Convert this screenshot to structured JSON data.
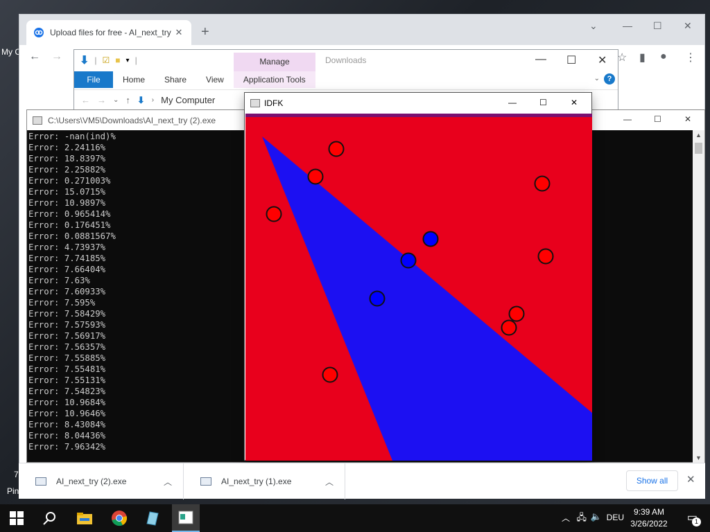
{
  "desktop": {
    "icon_label_1": "My C",
    "icon_label_2": "Pin",
    "icon_label_3": "7"
  },
  "chrome": {
    "tab_title": "Upload files for free - AI_next_try",
    "downloads": [
      {
        "name": "AI_next_try (2).exe"
      },
      {
        "name": "AI_next_try (1).exe"
      }
    ],
    "show_all": "Show all"
  },
  "explorer": {
    "manage": "Manage",
    "downloads_title": "Downloads",
    "ribbon": {
      "file": "File",
      "home": "Home",
      "share": "Share",
      "view": "View",
      "app_tools": "Application Tools"
    },
    "address": "My Computer"
  },
  "console": {
    "title": "C:\\Users\\VM5\\Downloads\\AI_next_try (2).exe",
    "lines": [
      "Error: -nan(ind)%",
      "Error: 2.24116%",
      "Error: 18.8397%",
      "Error: 2.25882%",
      "Error: 0.271003%",
      "Error: 15.0715%",
      "Error: 10.9897%",
      "Error: 0.965414%",
      "Error: 0.176451%",
      "Error: 0.0881567%",
      "Error: 4.73937%",
      "Error: 7.74185%",
      "Error: 7.66404%",
      "Error: 7.63%",
      "Error: 7.60933%",
      "Error: 7.595%",
      "Error: 7.58429%",
      "Error: 7.57593%",
      "Error: 7.56917%",
      "Error: 7.56357%",
      "Error: 7.55885%",
      "Error: 7.55481%",
      "Error: 7.55131%",
      "Error: 7.54823%",
      "Error: 10.9684%",
      "Error: 10.9646%",
      "Error: 8.43084%",
      "Error: 8.04436%",
      "Error: 7.96342%"
    ]
  },
  "idfk": {
    "title": "IDFK",
    "colors": {
      "red_region": "#e8001c",
      "blue_region": "#1c10f2",
      "red_point": "#ff0000",
      "blue_point": "#0000ff"
    }
  },
  "taskbar": {
    "lang": "DEU",
    "time": "9:39 AM",
    "date": "3/26/2022",
    "notifications": "1"
  }
}
